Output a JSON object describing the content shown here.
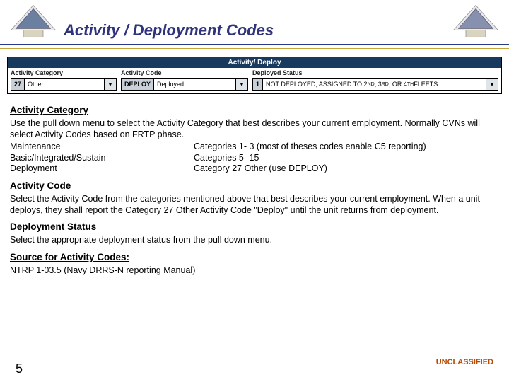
{
  "title": "Activity / Deployment Codes",
  "panel": {
    "header": "Activity/ Deploy",
    "fields": {
      "activity_category": {
        "label": "Activity Category",
        "code": "27",
        "text": "Other"
      },
      "activity_code": {
        "label": "Activity Code",
        "code": "DEPLOY",
        "text": "Deployed"
      },
      "deployed_status": {
        "label": "Deployed Status",
        "code": "1",
        "text_pre": "NOT DEPLOYED, ASSIGNED TO 2",
        "sup1": "ND",
        "mid1": ", 3",
        "sup2": "RD",
        "mid2": ", OR 4",
        "sup3": "TH",
        "text_post": " FLEETS"
      }
    }
  },
  "sections": {
    "activity_category": {
      "heading": "Activity Category",
      "p1": "Use the pull down menu to select the Activity Category that best describes your current employment.  Normally CVNs will select Activity Codes based on FRTP phase.",
      "rows": [
        {
          "l": "Maintenance",
          "r": "Categories 1- 3 (most of theses codes enable C5 reporting)"
        },
        {
          "l": "Basic/Integrated/Sustain",
          "r": "Categories 5- 15"
        },
        {
          "l": "Deployment",
          "r": "Category 27 Other (use DEPLOY)"
        }
      ]
    },
    "activity_code": {
      "heading": "Activity Code",
      "p1": "Select the Activity Code from the categories mentioned above that best describes your current employment. When a unit deploys, they shall report the Category 27 Other Activity Code \"Deploy\" until the unit returns from deployment."
    },
    "deployment_status": {
      "heading": "Deployment Status",
      "p1": "Select the appropriate deployment status from the pull down menu."
    },
    "source": {
      "heading": "Source for Activity Codes:",
      "p1": "NTRP 1-03.5 (Navy DRRS-N reporting Manual)"
    }
  },
  "classification": "UNCLASSIFIED",
  "page": "5",
  "caret": "▼"
}
